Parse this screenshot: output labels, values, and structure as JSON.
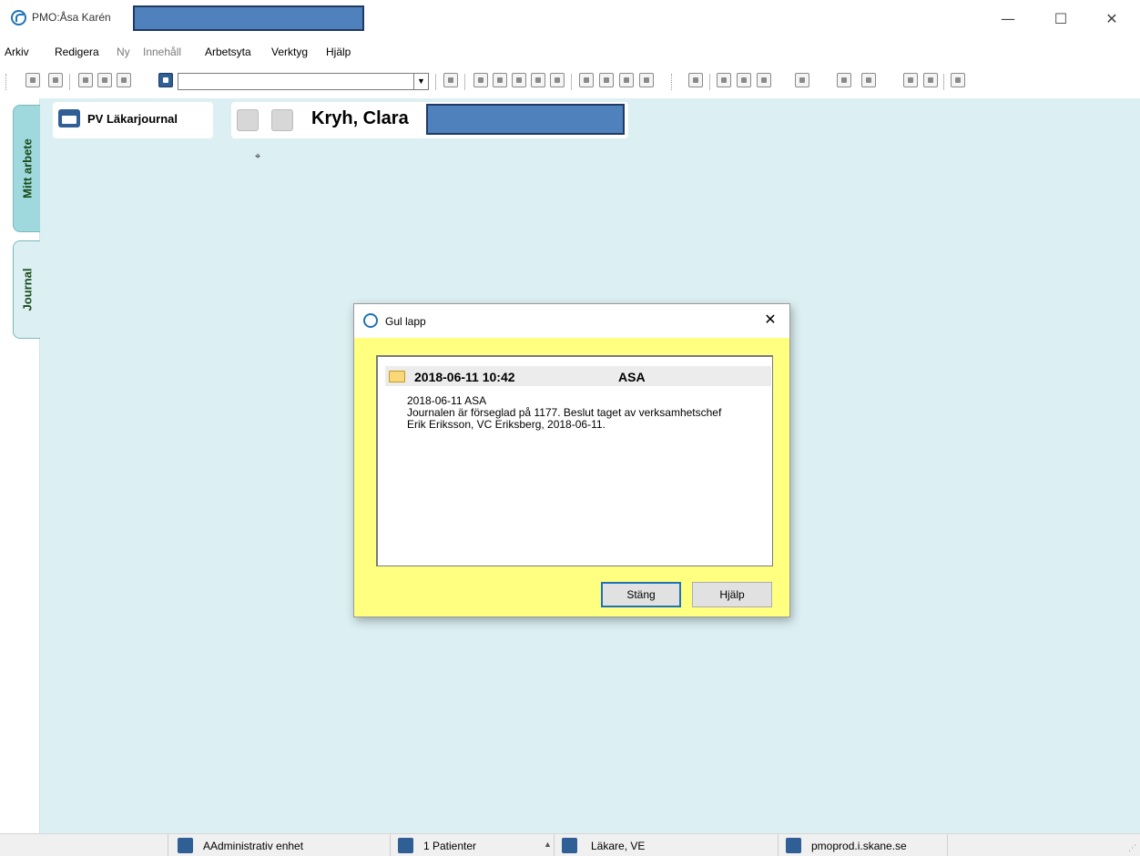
{
  "window": {
    "title": "PMO:Åsa Karén",
    "minimize_glyph": "—",
    "maximize_glyph": "☐",
    "close_glyph": "✕"
  },
  "menu": {
    "items": [
      {
        "label": "Arkiv",
        "enabled": true
      },
      {
        "label": "Redigera",
        "enabled": true
      },
      {
        "label": "Ny",
        "enabled": false
      },
      {
        "label": "Innehåll",
        "enabled": false
      },
      {
        "label": "Arbetsyta",
        "enabled": true
      },
      {
        "label": "Verktyg",
        "enabled": true
      },
      {
        "label": "Hjälp",
        "enabled": true
      }
    ]
  },
  "toolbar": {
    "combo_value": "",
    "combo_arrow": "▼"
  },
  "sidebar": {
    "tabs": [
      {
        "label": "Mitt arbete",
        "active": false
      },
      {
        "label": "Journal",
        "active": true
      }
    ]
  },
  "workspace": {
    "journal_label": "PV Läkarjournal",
    "patient_name": "Kryh, Clara",
    "pin_glyph": "⌖"
  },
  "dialog": {
    "title": "Gul lapp",
    "close_glyph": "✕",
    "note": {
      "date": "2018-06-11 10:42",
      "author": "ASA",
      "lines": [
        "2018-06-11 ASA",
        "Journalen är förseglad på 1177. Beslut taget av verksamhetschef",
        "Erik Eriksson, VC Eriksberg, 2018-06-11."
      ]
    },
    "buttons": {
      "close_label": "Stäng",
      "help_label": "Hjälp"
    }
  },
  "statusbar": {
    "unit": "AAdministrativ enhet",
    "patients": "1 Patienter",
    "role": "Läkare, VE",
    "server": "pmoprod.i.skane.se",
    "arrow": "▲",
    "grip": "⋰"
  }
}
